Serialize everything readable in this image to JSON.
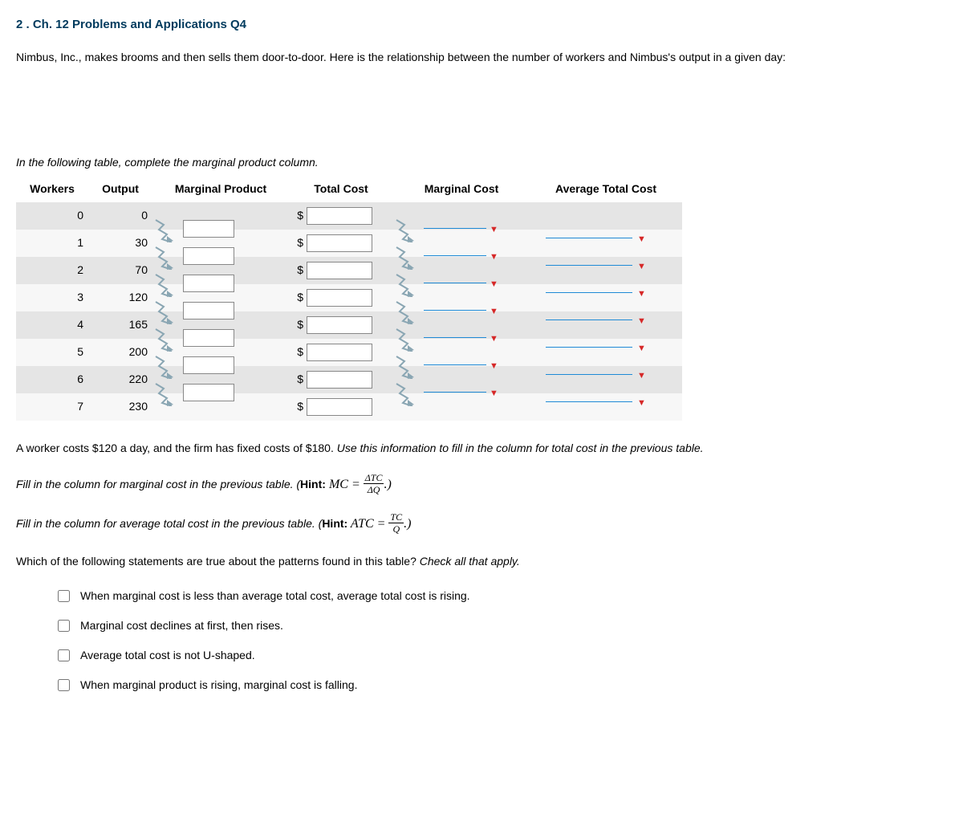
{
  "title": "2 . Ch. 12 Problems and Applications Q4",
  "intro": "Nimbus, Inc., makes brooms and then sells them door-to-door. Here is the relationship between the number of workers and Nimbus's output in a given day:",
  "instruction1": "In the following table, complete the marginal product column.",
  "headers": {
    "workers": "Workers",
    "output": "Output",
    "mp": "Marginal Product",
    "tc": "Total Cost",
    "mc": "Marginal Cost",
    "atc": "Average Total Cost"
  },
  "rows": [
    {
      "workers": "0",
      "output": "0"
    },
    {
      "workers": "1",
      "output": "30"
    },
    {
      "workers": "2",
      "output": "70"
    },
    {
      "workers": "3",
      "output": "120"
    },
    {
      "workers": "4",
      "output": "165"
    },
    {
      "workers": "5",
      "output": "200"
    },
    {
      "workers": "6",
      "output": "220"
    },
    {
      "workers": "7",
      "output": "230"
    }
  ],
  "currency": "$",
  "para_tc_a": "A worker costs $120 a day, and the firm has fixed costs of $180. ",
  "para_tc_b": "Use this information to fill in the column for total cost in the previous table.",
  "para_mc_a": "Fill in the column for marginal cost in the previous table. (",
  "para_mc_hint": "Hint:",
  "para_mc_b": " MC = ",
  "frac_mc_num": "ΔTC",
  "frac_mc_den": "ΔQ",
  "para_mc_c": ".)",
  "para_atc_a": "Fill in the column for average total cost in the previous table. (",
  "para_atc_hint": "Hint:",
  "para_atc_b": " ATC = ",
  "frac_atc_num": "TC",
  "frac_atc_den": "Q",
  "para_atc_c": ".)",
  "question_stem": "Which of the following statements are true about the patterns found in this table? ",
  "question_stem_it": "Check all that apply.",
  "options": [
    "When marginal cost is less than average total cost, average total cost is rising.",
    "Marginal cost declines at first, then rises.",
    "Average total cost is not U-shaped.",
    "When marginal product is rising, marginal cost is falling."
  ]
}
